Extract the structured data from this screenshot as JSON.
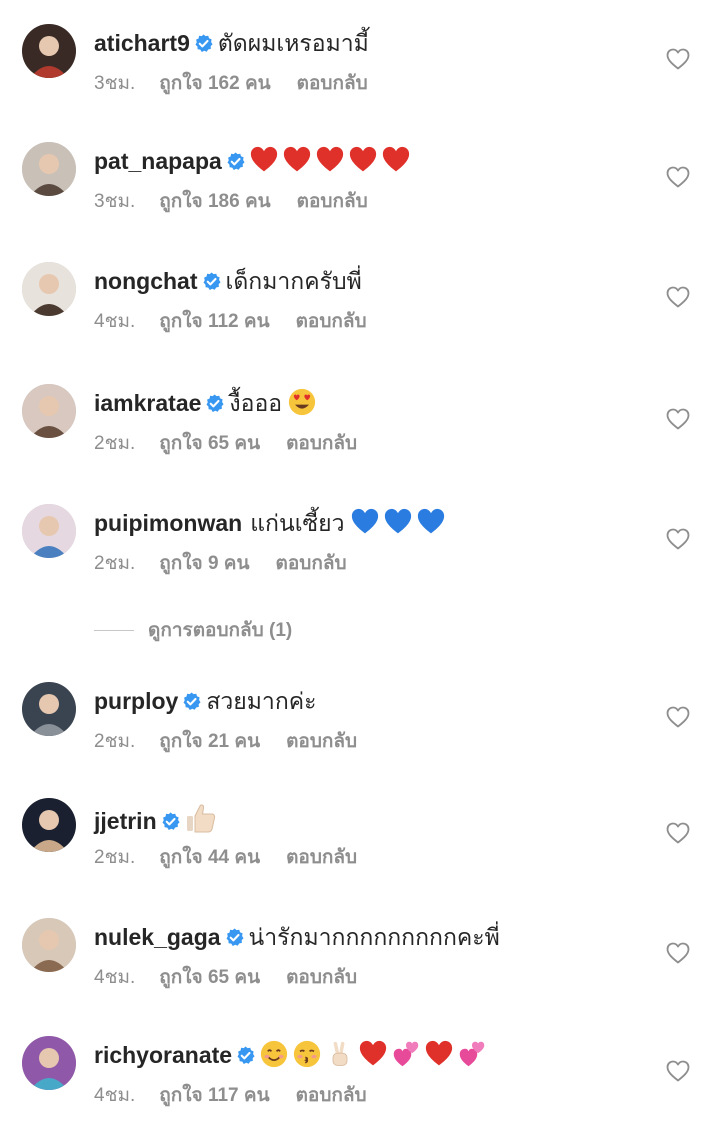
{
  "comments": [
    {
      "username": "atichart9",
      "text": "ตัดผมเหรอมามี้",
      "time": "3ชม.",
      "likes": "ถูกใจ 162 คน",
      "reply": "ตอบกลับ",
      "verified": true,
      "emojis": []
    },
    {
      "username": "pat_napapa",
      "text": "",
      "time": "3ชม.",
      "likes": "ถูกใจ 186 คน",
      "reply": "ตอบกลับ",
      "verified": true,
      "emojis": [
        "red-heart",
        "red-heart",
        "red-heart",
        "red-heart",
        "red-heart"
      ]
    },
    {
      "username": "nongchat",
      "text": "เด็กมากครับพี่",
      "time": "4ชม.",
      "likes": "ถูกใจ 112 คน",
      "reply": "ตอบกลับ",
      "verified": true,
      "emojis": []
    },
    {
      "username": "iamkratae",
      "text": "งื้อออ",
      "time": "2ชม.",
      "likes": "ถูกใจ 65 คน",
      "reply": "ตอบกลับ",
      "verified": true,
      "emojis": [
        "heart-eyes"
      ]
    },
    {
      "username": "puipimonwan",
      "text": "แก่นเซี้ยว",
      "time": "2ชม.",
      "likes": "ถูกใจ 9 คน",
      "reply": "ตอบกลับ",
      "verified": false,
      "emojis": [
        "blue-heart",
        "blue-heart",
        "blue-heart"
      ]
    },
    {
      "username": "purploy",
      "text": "สวยมากค่ะ",
      "time": "2ชม.",
      "likes": "ถูกใจ 21 คน",
      "reply": "ตอบกลับ",
      "verified": true,
      "emojis": []
    },
    {
      "username": "jjetrin",
      "text": "",
      "time": "2ชม.",
      "likes": "ถูกใจ 44 คน",
      "reply": "ตอบกลับ",
      "verified": true,
      "emojis": [
        "thumbs-up"
      ]
    },
    {
      "username": "nulek_gaga",
      "text": "น่ารักมากกกกกกกกกคะพี่",
      "time": "4ชม.",
      "likes": "ถูกใจ 65 คน",
      "reply": "ตอบกลับ",
      "verified": true,
      "emojis": []
    },
    {
      "username": "richyoranate",
      "text": "",
      "time": "4ชม.",
      "likes": "ถูกใจ 117 คน",
      "reply": "ตอบกลับ",
      "verified": true,
      "emojis": [
        "smile",
        "kiss",
        "victory-hand",
        "red-heart",
        "two-hearts",
        "red-heart",
        "two-hearts"
      ]
    }
  ],
  "view_replies": "ดูการตอบกลับ (1)",
  "colors": {
    "verified": "#3897f0",
    "meta": "#8e8e8e",
    "text": "#262626"
  }
}
